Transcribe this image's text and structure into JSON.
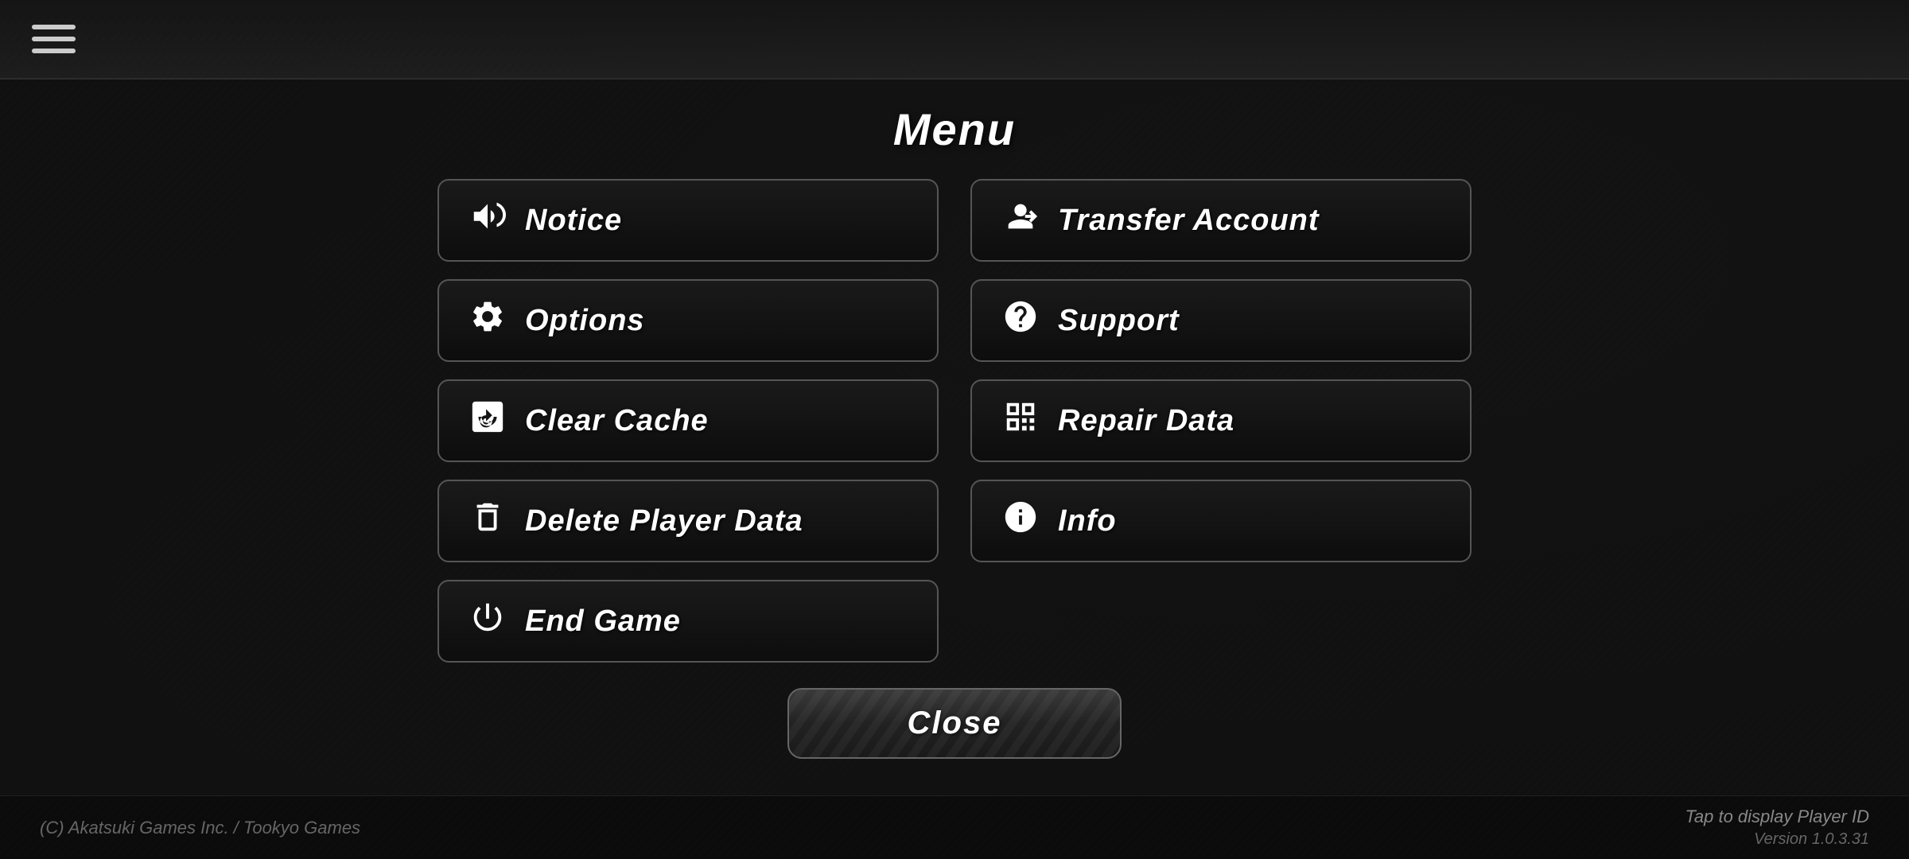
{
  "header": {
    "hamburger_label": "menu"
  },
  "menu": {
    "title": "Menu",
    "buttons_left": [
      {
        "id": "notice",
        "label": "Notice",
        "icon": "megaphone"
      },
      {
        "id": "options",
        "label": "Options",
        "icon": "gear"
      },
      {
        "id": "clear-cache",
        "label": "Clear Cache",
        "icon": "cache"
      },
      {
        "id": "delete-player-data",
        "label": "Delete Player Data",
        "icon": "trash"
      },
      {
        "id": "end-game",
        "label": "End Game",
        "icon": "power"
      }
    ],
    "buttons_right": [
      {
        "id": "transfer-account",
        "label": "Transfer Account",
        "icon": "transfer"
      },
      {
        "id": "support",
        "label": "Support",
        "icon": "question"
      },
      {
        "id": "repair-data",
        "label": "Repair Data",
        "icon": "repair"
      },
      {
        "id": "info",
        "label": "Info",
        "icon": "info"
      }
    ],
    "close_label": "Close"
  },
  "footer": {
    "copyright": "(C) Akatsuki Games Inc. / Tookyo Games",
    "tap_display": "Tap to display Player ID",
    "version": "Version 1.0.3.31"
  }
}
